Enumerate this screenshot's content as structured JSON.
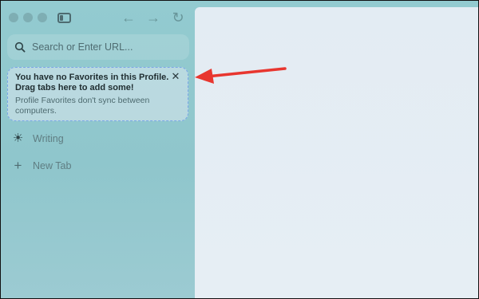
{
  "sidebar": {
    "url_placeholder": "Search or Enter URL...",
    "favorites_notice": {
      "title": "You have no Favorites in this Profile. Drag tabs here to add some!",
      "subtitle": "Profile Favorites don't sync between computers.",
      "close_glyph": "✕"
    },
    "items": [
      {
        "label": "Writing",
        "icon": "sun-icon",
        "glyph": "☀"
      },
      {
        "label": "New Tab",
        "icon": "plus-icon",
        "glyph": "+"
      }
    ]
  },
  "toolbar": {
    "back_glyph": "←",
    "forward_glyph": "→",
    "reload_glyph": "↻"
  },
  "colors": {
    "sidebar_bg": "#93cbd0",
    "content_bg": "#e3ecf3",
    "annotation_arrow": "#e8362f",
    "favorites_border": "#7aa6e8"
  }
}
